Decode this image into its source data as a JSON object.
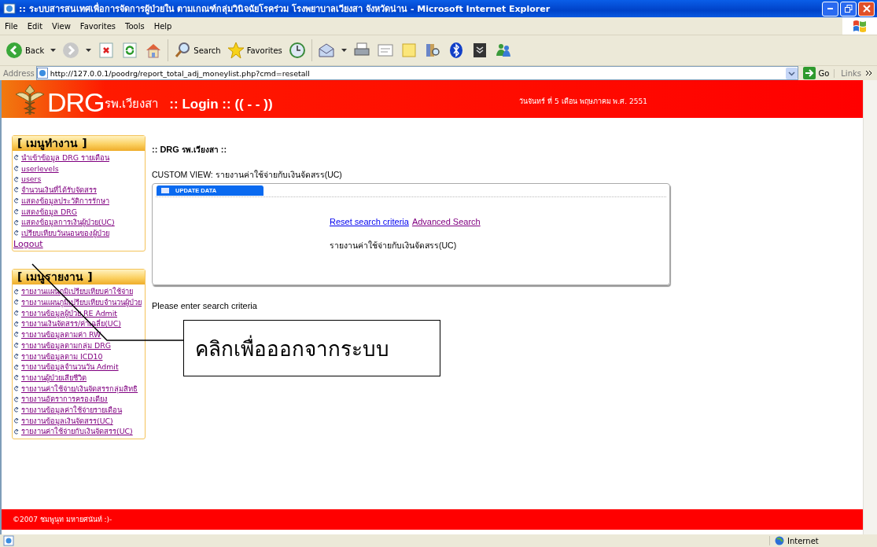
{
  "window": {
    "title": ":: ระบบสารสนเทศเพื่อการจัดการผู้ป่วยใน ตามเกณฑ์กลุ่มวินิจฉัยโรคร่วม โรงพยาบาลเวียงสา จังหวัดน่าน - Microsoft Internet Explorer"
  },
  "menu_bar": [
    "File",
    "Edit",
    "View",
    "Favorites",
    "Tools",
    "Help"
  ],
  "toolbar": [
    {
      "kind": "back",
      "label": "Back"
    },
    {
      "kind": "forward"
    },
    {
      "kind": "stop"
    },
    {
      "kind": "refresh"
    },
    {
      "kind": "home"
    },
    {
      "kind": "search",
      "label": "Search"
    },
    {
      "kind": "favorites",
      "label": "Favorites"
    },
    {
      "kind": "history"
    },
    {
      "kind": "mail"
    },
    {
      "kind": "print"
    },
    {
      "kind": "edit"
    },
    {
      "kind": "note"
    },
    {
      "kind": "research"
    },
    {
      "kind": "bluetooth"
    },
    {
      "kind": "tool"
    },
    {
      "kind": "messenger"
    }
  ],
  "address_bar": {
    "label": "Address",
    "url": "http://127.0.0.1/poodrg/report_total_adj_moneylist.php?cmd=resetall",
    "go": "Go",
    "links": "Links"
  },
  "header": {
    "logo_text": "DRG",
    "logo_sub": "รพ.เวียงสา",
    "login": ":: Login :: (( - - ))",
    "date": "วันจันทร์ ที่ 5 เดือน พฤษภาคม พ.ศ. 2551"
  },
  "sidebar": [
    {
      "title": "[ เมนูทำงาน ]",
      "items": [
        {
          "kind": "bullet",
          "label": "นำเข้าข้อมูล DRG รายเดือน"
        },
        {
          "kind": "bullet",
          "label": "userlevels"
        },
        {
          "kind": "bullet",
          "label": "users"
        },
        {
          "kind": "bullet",
          "label": "จำนวนเงินที่ได้รับจัดสรร"
        },
        {
          "kind": "bullet",
          "label": "แสดงข้อมูลประวัติการรักษา"
        },
        {
          "kind": "bullet",
          "label": "แสดงข้อมูล DRG"
        },
        {
          "kind": "bullet",
          "label": "แสดงข้อมูลการเงินผู้ป่วย(UC)"
        },
        {
          "kind": "bullet",
          "label": "เปรียบเทียบวันนอนของผู้ป่วย"
        },
        {
          "kind": "plain",
          "label": "Logout"
        }
      ]
    },
    {
      "title": "[ เมนูรายงาน ]",
      "items": [
        {
          "kind": "bullet",
          "label": "รายงานแผนภูมิเปรียบเทียบค่าใช้จ่าย"
        },
        {
          "kind": "bullet",
          "label": "รายงานแผนภูมิเปรียบเทียบจำนวนผู้ป่วย"
        },
        {
          "kind": "bullet",
          "label": "รายงานข้อมูลผู้ป่วย RE Admit"
        },
        {
          "kind": "bullet",
          "label": "รายงานเงินจัดสรร/ค่าเฉลี่ย(UC)"
        },
        {
          "kind": "bullet",
          "label": "รายงานข้อมูลตามค่า RW"
        },
        {
          "kind": "bullet",
          "label": "รายงานข้อมูลตามกลุ่ม DRG"
        },
        {
          "kind": "bullet",
          "label": "รายงานข้อมูลตาม ICD10"
        },
        {
          "kind": "bullet",
          "label": "รายงานข้อมูลจำนวนวัน Admit"
        },
        {
          "kind": "bullet",
          "label": "รายงานผู้ป่วยเสียชีวิต"
        },
        {
          "kind": "bullet",
          "label": "รายงานค่าใช้จ่าย/เงินจัดสรรกลุ่มสิทธิ"
        },
        {
          "kind": "bullet",
          "label": "รายงานอัตราการครองเตียง"
        },
        {
          "kind": "bullet",
          "label": "รายงานข้อมูลค่าใช้จ่ายรายเดือน"
        },
        {
          "kind": "bullet",
          "label": "รายงานข้อมูลเงินจัดสรร(UC)"
        },
        {
          "kind": "bullet",
          "label": "รายงานค่าใช้จ่ายกับเงินจัดสรร(UC)"
        }
      ]
    }
  ],
  "main": {
    "heading_prefix": ":: DRG",
    "heading_name": "รพ.เวียงสา",
    "heading_suffix": "::",
    "custom_view": "CUSTOM VIEW: รายงานค่าใช้จ่ายกับเงินจัดสรร(UC)",
    "tab": "UPDATE DATA",
    "links": [
      {
        "label": "Reset search criteria",
        "visited": false
      },
      {
        "label": "Advanced Search",
        "visited": true
      }
    ],
    "report_title": "รายงานค่าใช้จ่ายกับเงินจัดสรร(UC)",
    "message": "Please enter search criteria"
  },
  "callout": {
    "text": "คลิกเพื่อออกจากระบบ"
  },
  "footer": "©2007 ชมพูนุท มหายศนันท์ :)-",
  "status_bar": {
    "zone": "Internet"
  }
}
